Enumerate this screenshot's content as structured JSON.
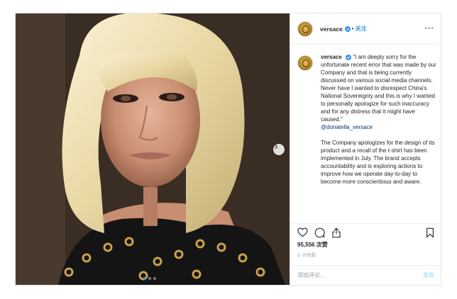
{
  "colors": {
    "accent": "#3897f0",
    "muted": "#999999",
    "text": "#262626",
    "post_disabled": "#b2dffc"
  },
  "header": {
    "username": "versace",
    "separator": "•",
    "follow_label": "关注",
    "more_label": "···"
  },
  "caption": {
    "username": "versace",
    "quote": "\"I am deeply sorry for the unfortunate recent error that was made by our Company and that is being currently discussed on various social media channels. Never have I wanted to disrespect China's National Sovereignty and this is why I wanted to personally apologize for such inaccuracy and for any distress that it might have caused.\"",
    "mention": "@donatella_versace",
    "paragraph2": "The Company apologizes for the design of its product and a recall of the t-shirt has been implemented in July. The brand accepts accountability and is exploring actions to improve how we operate day-to-day to become more conscientious and aware."
  },
  "actions": {
    "icons": [
      "heart-icon",
      "comment-icon",
      "share-icon",
      "bookmark-icon"
    ],
    "likes": "95,556 次赞",
    "time": "2 小时前"
  },
  "comment": {
    "placeholder": "添加评论...",
    "post_label": "发布"
  },
  "carousel": {
    "slide_count": 3,
    "current_slide": 1
  }
}
